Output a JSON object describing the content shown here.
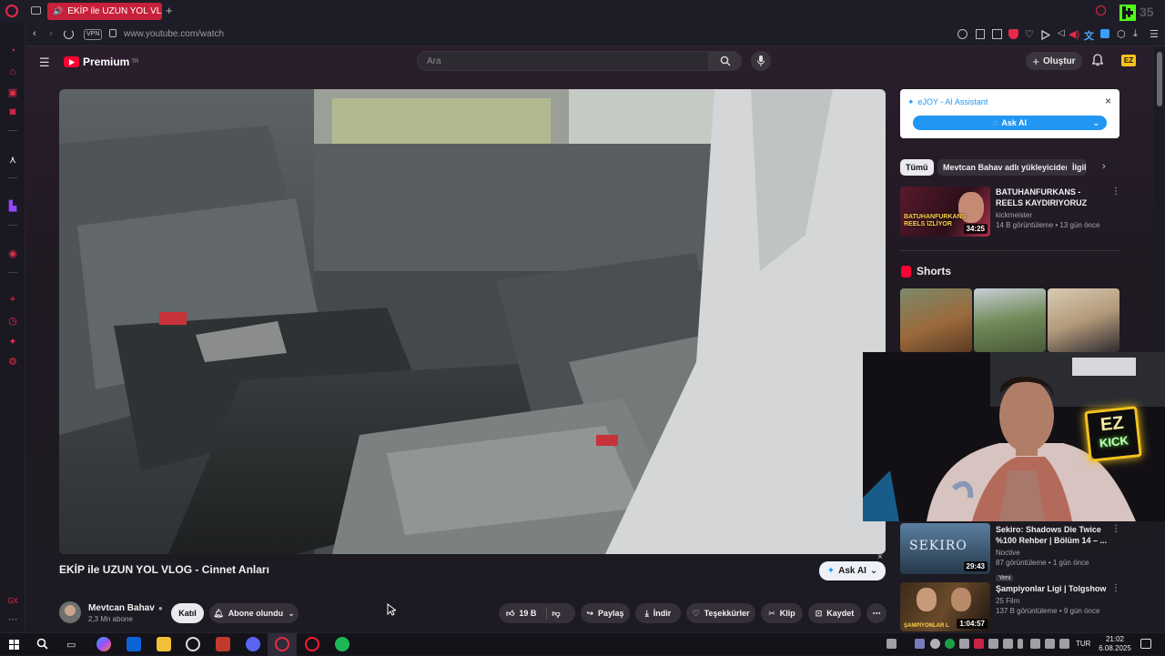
{
  "browser": {
    "tab_title": "EKİP ile UZUN YOL VL",
    "url": "www.youtube.com/watch",
    "vpn_label": "VPN",
    "overlay_number": "35"
  },
  "youtube": {
    "brand": "Premium",
    "brand_sup": "TR",
    "search_placeholder": "Ara",
    "create_label": "Oluştur",
    "video": {
      "title": "EKİP ile UZUN YOL VLOG - Cinnet Anları",
      "ask_ai": "Ask AI"
    },
    "channel": {
      "name": "Mevtcan Bahav",
      "subs": "2,3 Mn abone",
      "join": "Katıl",
      "subscribed": "Abone olundu"
    },
    "actions": {
      "likes": "19 B",
      "share": "Paylaş",
      "download": "İndir",
      "thanks": "Teşekkürler",
      "clip": "Klip",
      "save": "Kaydet"
    },
    "ejoy": {
      "title": "eJOY - AI Assistant",
      "ask": "Ask AI"
    },
    "chips": [
      "Tümü",
      "Mevtcan Bahav adlı yükleyiciden",
      "İlgili"
    ],
    "rec1": {
      "title": "BATUHANFURKANS - REELS KAYDIRIYORUZ",
      "channel": "kickmeister",
      "meta": "14 B görüntüleme • 13 gün önce",
      "duration": "34:25",
      "thumb_text": "BATUHANFURKANS\nREELS İZLİYOR"
    },
    "shorts_label": "Shorts",
    "rec2": {
      "title": "Sekiro: Shadows Die Twice %100 Rehber | Bölüm 14 – ...",
      "channel": "Noctive",
      "meta": "87 görüntüleme • 1 gün önce",
      "badge": "Yeni",
      "duration": "29:43",
      "thumb_text": "SEKIRO"
    },
    "rec3": {
      "title": "Şampiyonlar Ligi | Tolgshow",
      "channel": "25 Film",
      "meta": "137 B görüntüleme • 9 gün önce",
      "duration": "1:04:57",
      "thumb_text": "ŞAMPİYONLAR L"
    }
  },
  "webcam": {
    "logo_line1": "EZ",
    "logo_line2": "KICK"
  },
  "taskbar": {
    "lang": "TUR",
    "time": "21:02",
    "date": "6.08.2025"
  },
  "colors": {
    "opera_red": "#e8294a",
    "yt_red": "#ff0033",
    "kick_green": "#53fc18",
    "ejoy_blue": "#2196f3"
  }
}
